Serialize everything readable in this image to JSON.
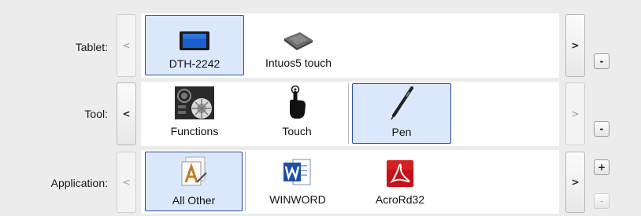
{
  "tablet": {
    "label": "Tablet:",
    "prev_label": "<",
    "next_label": ">",
    "remove_label": "-",
    "items": [
      {
        "label": "DTH-2242",
        "icon": "display-tablet-icon",
        "selected": true
      },
      {
        "label": "Intuos5 touch",
        "icon": "pen-tablet-icon",
        "selected": false
      }
    ]
  },
  "tool": {
    "label": "Tool:",
    "prev_label": "<",
    "next_label": ">",
    "remove_label": "-",
    "items": [
      {
        "label": "Functions",
        "icon": "functions-icon",
        "selected": false
      },
      {
        "label": "Touch",
        "icon": "touch-hand-icon",
        "selected": false
      },
      {
        "label": "Pen",
        "icon": "pen-icon",
        "selected": true
      }
    ]
  },
  "application": {
    "label": "Application:",
    "prev_label": "<",
    "next_label": ">",
    "add_label": "+",
    "remove_label": "-",
    "items": [
      {
        "label": "All Other",
        "icon": "all-other-apps-icon",
        "selected": true
      },
      {
        "label": "WINWORD",
        "icon": "word-icon",
        "selected": false
      },
      {
        "label": "AcroRd32",
        "icon": "acrobat-icon",
        "selected": false
      }
    ]
  },
  "colors": {
    "selection_fill": "#dbe7fb",
    "selection_border": "#2d4ea3",
    "background": "#ececec"
  }
}
